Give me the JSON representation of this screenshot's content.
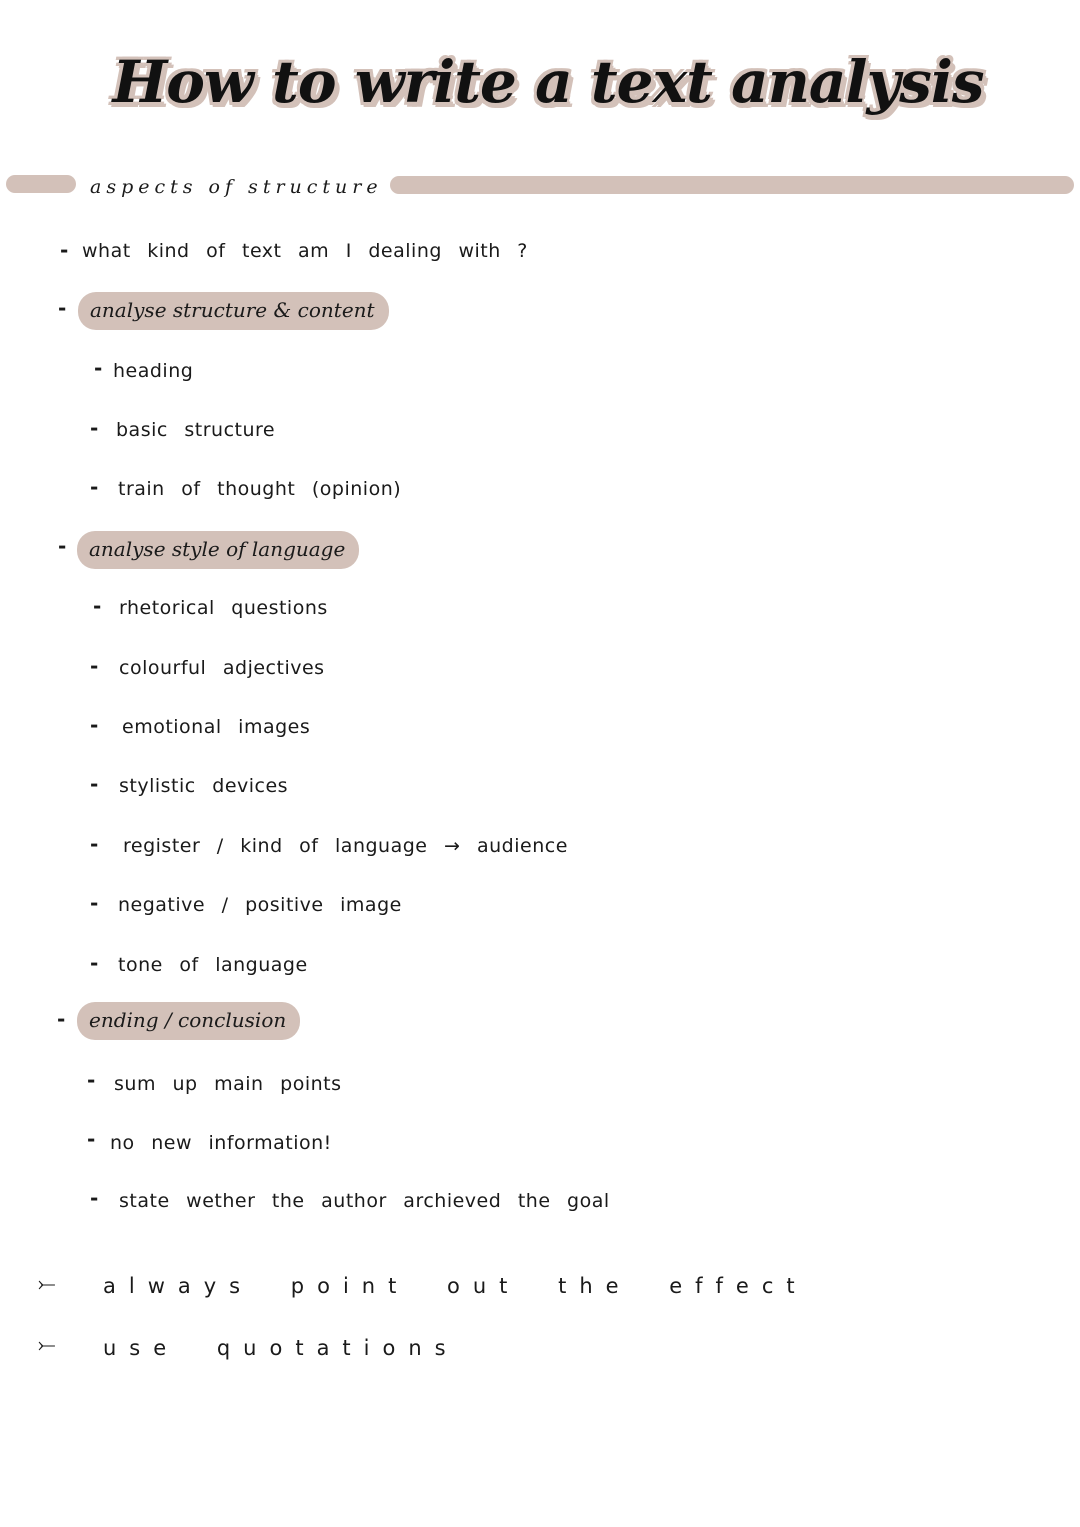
{
  "colors": {
    "accent": "#d3c1b9",
    "text": "#1a1a1a",
    "background": "#ffffff"
  },
  "title": "How to write a text analysis",
  "section_header": "aspects of structure",
  "intro_item": "what kind of text am I dealing with ?",
  "groups": [
    {
      "heading": "analyse structure & content",
      "items": [
        "heading",
        "basic structure",
        "train of thought (opinion)"
      ]
    },
    {
      "heading": "analyse style of language",
      "items": [
        "rhetorical questions",
        "colourful adjectives",
        "emotional images",
        "stylistic devices",
        "register / kind of language → audience",
        "negative / positive image",
        "tone of language"
      ]
    },
    {
      "heading": "ending / conclusion",
      "items": [
        "sum up main points",
        "no new information!",
        "state wether the author archieved the goal"
      ]
    }
  ],
  "tips": [
    "always point out the effect",
    "use quotations"
  ],
  "bullet_symbol": "-",
  "tip_arrow": "⤚"
}
